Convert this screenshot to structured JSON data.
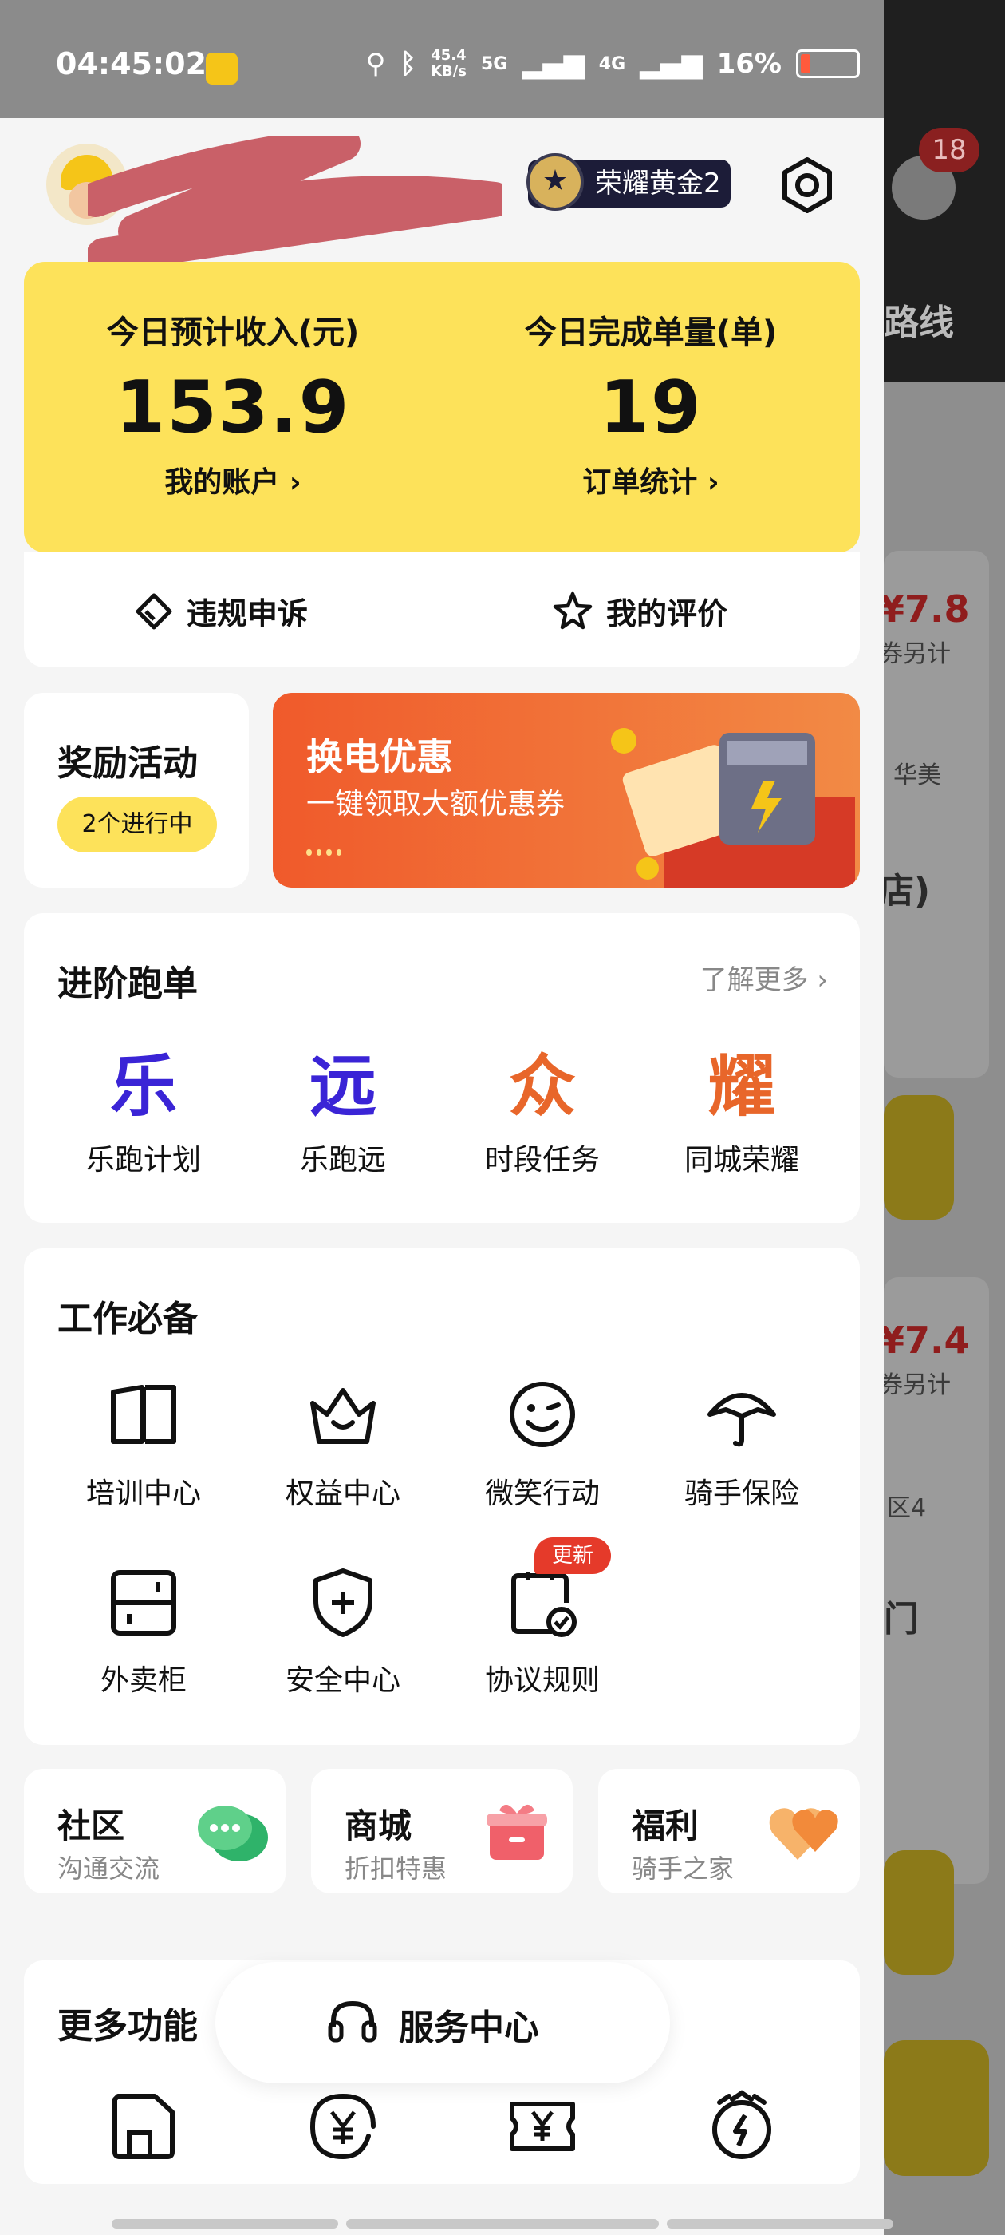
{
  "status_bar": {
    "time": "04:45:02",
    "net_speed_top": "45.4",
    "net_speed_bottom": "KB/s",
    "net1": "5G",
    "net2": "4G",
    "battery": "16%"
  },
  "header": {
    "rank": "荣耀黄金2",
    "notification_count": "18"
  },
  "earnings_card": {
    "income_label": "今日预计收入(元)",
    "income_value": "153.9",
    "income_link": "我的账户",
    "orders_label": "今日完成单量(单)",
    "orders_value": "19",
    "orders_link": "订单统计"
  },
  "quick_actions": {
    "appeal": "违规申诉",
    "rating": "我的评价"
  },
  "reward": {
    "title": "奖励活动",
    "status": "2个进行中"
  },
  "banner": {
    "title": "换电优惠",
    "subtitle": "一键领取大额优惠券"
  },
  "advanced": {
    "title": "进阶跑单",
    "more": "了解更多",
    "items": [
      {
        "char": "乐",
        "label": "乐跑计划",
        "color": "#3a24d6"
      },
      {
        "char": "远",
        "label": "乐跑远",
        "color": "#3a24d6"
      },
      {
        "char": "众",
        "label": "时段任务",
        "color": "#e8662a"
      },
      {
        "char": "耀",
        "label": "同城荣耀",
        "color": "#e8662a"
      }
    ]
  },
  "essentials": {
    "title": "工作必备",
    "items": [
      {
        "label": "培训中心",
        "icon": "book-icon"
      },
      {
        "label": "权益中心",
        "icon": "crown-icon"
      },
      {
        "label": "微笑行动",
        "icon": "smile-icon"
      },
      {
        "label": "骑手保险",
        "icon": "umbrella-icon"
      },
      {
        "label": "外卖柜",
        "icon": "locker-icon"
      },
      {
        "label": "安全中心",
        "icon": "shield-plus-icon"
      },
      {
        "label": "协议规则",
        "icon": "document-check-icon"
      }
    ],
    "new_badge": "更新"
  },
  "tiles": [
    {
      "title": "社区",
      "sub": "沟通交流",
      "icon": "chat-bubbles-icon"
    },
    {
      "title": "商城",
      "sub": "折扣特惠",
      "icon": "gift-box-icon"
    },
    {
      "title": "福利",
      "sub": "骑手之家",
      "icon": "heart-icon"
    }
  ],
  "more": {
    "title": "更多功能"
  },
  "service": {
    "label": "服务中心"
  },
  "underlay": {
    "title_fragment": "路线",
    "price1": "¥7.8",
    "sub1": "券另计",
    "text1": "华美",
    "text2": "店)",
    "price2": "¥7.4",
    "sub2": "券另计",
    "text3": "区4",
    "text4": "门"
  },
  "colors": {
    "yellow": "#fde25a",
    "orange": "#f05a2b",
    "purple": "#3a24d6"
  }
}
